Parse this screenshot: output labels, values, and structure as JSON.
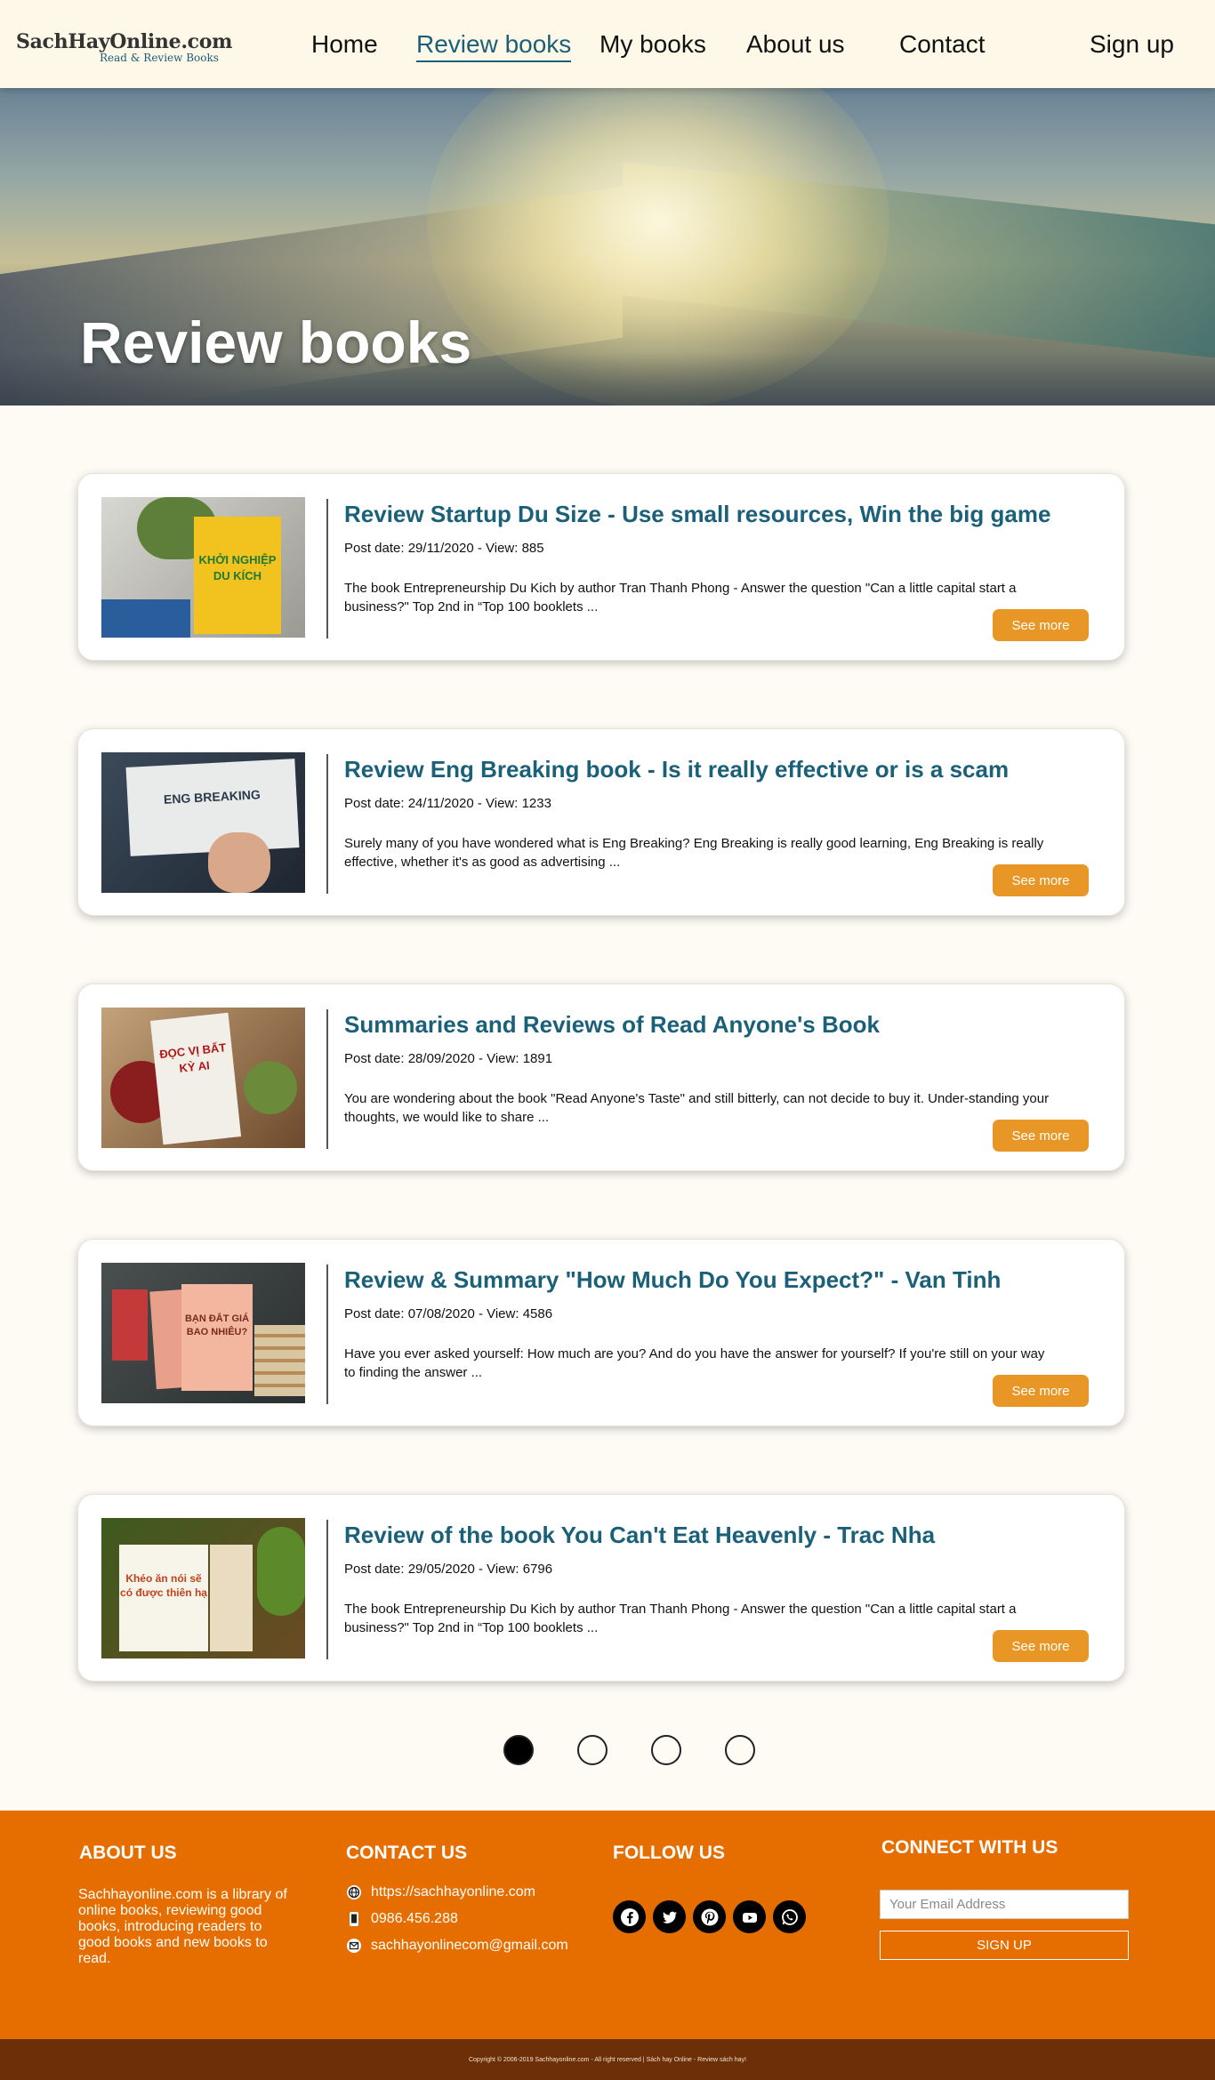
{
  "header": {
    "logo_main": "SachHayOnline.com",
    "logo_sub": "Read & Review Books",
    "nav": [
      "Home",
      "Review books",
      "My books",
      "About us",
      "Contact"
    ],
    "active_nav": "Review books",
    "signup": "Sign up"
  },
  "hero": {
    "title": "Review books"
  },
  "reviews": [
    {
      "title": "Review Startup Du Size - Use small resources, Win the big game",
      "meta": "Post date: 29/11/2020 - View: 885",
      "desc": "The book Entrepreneurship Du Kich by author Tran Thanh Phong - Answer the question \"Can a little capital start a business?\" Top 2nd in “Top 100 booklets ...",
      "button": "See more",
      "cover_text": "KHỞI NGHIỆP DU KÍCH"
    },
    {
      "title": "Review Eng Breaking book - Is it really effective or is a scam",
      "meta": "Post date: 24/11/2020 - View: 1233",
      "desc": "Surely many of you have wondered what is Eng Breaking? Eng Breaking is really good learning, Eng Breaking is really effective, whether it's as good as advertising ...",
      "button": "See more",
      "cover_text": "ENG BREAKING"
    },
    {
      "title": "Summaries and Reviews of Read Anyone's Book",
      "meta": "Post date: 28/09/2020 - View: 1891",
      "desc": "You are wondering about the book \"Read Anyone's Taste\" and still bitterly, can not decide to buy it. Under-standing your thoughts, we would like to share ...",
      "button": "See more",
      "cover_text": "ĐỌC VỊ BẤT KỲ AI"
    },
    {
      "title": "Review & Summary \"How Much Do You Expect?\" - Van Tinh",
      "meta": "Post date: 07/08/2020 - View: 4586",
      "desc": "Have you ever asked yourself: How much are you? And do you have the answer for yourself? If you're still on your way to finding the answer ...",
      "button": "See more",
      "cover_text": "BẠN ĐẮT GIÁ BAO NHIÊU?"
    },
    {
      "title": "Review of the book You Can't Eat Heavenly - Trac Nha",
      "meta": "Post date: 29/05/2020 - View: 6796",
      "desc": "The book Entrepreneurship Du Kich by author Tran Thanh Phong - Answer the question \"Can a little capital start a business?\" Top 2nd in “Top 100 booklets ...",
      "button": "See more",
      "cover_text": "Khéo ăn nói sẽ có được thiên hạ"
    }
  ],
  "pagination": {
    "pages": 4,
    "current": 1
  },
  "footer": {
    "about_heading": "ABOUT US",
    "about_text": "Sachhayonline.com is a library of online books, reviewing good books, introducing readers to good books and new books to read.",
    "contact_heading": "CONTACT US",
    "website": "https://sachhayonline.com",
    "phone": "0986.456.288",
    "email": "sachhayonlinecom@gmail.com",
    "follow_heading": "FOLLOW US",
    "socials": [
      "facebook-icon",
      "twitter-icon",
      "pinterest-icon",
      "youtube-icon",
      "whatsapp-icon"
    ],
    "connect_heading": "CONNECT WITH US",
    "email_placeholder": "Your Email Address",
    "signup_label": "SIGN UP",
    "copyright": "Copyright © 2006-2019 Sachhayonline.com - All right reserved | Sách hay Online - Review sách hay!"
  },
  "colors": {
    "accent_teal": "#1b6079",
    "button_orange": "#e89726",
    "footer_orange": "#e66e00",
    "footer_dark": "#6c2f08"
  }
}
